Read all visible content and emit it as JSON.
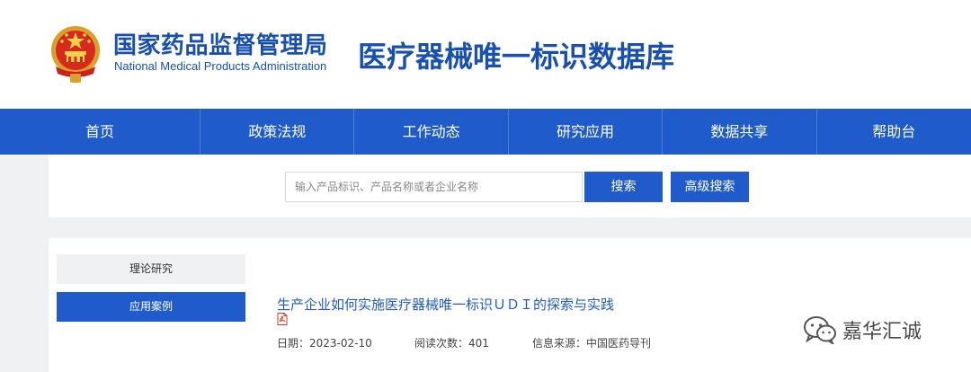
{
  "header": {
    "agency_name_cn": "国家药品监督管理局",
    "agency_name_en": "National Medical Products Administration",
    "database_title": "医疗器械唯一标识数据库",
    "brand_color": "#1750b0"
  },
  "nav": {
    "items": [
      {
        "label": "首页"
      },
      {
        "label": "政策法规"
      },
      {
        "label": "工作动态"
      },
      {
        "label": "研究应用"
      },
      {
        "label": "数据共享"
      },
      {
        "label": "帮助台"
      }
    ],
    "background": "#1f5bcb"
  },
  "search": {
    "placeholder": "输入产品标识、产品名称或者企业名称",
    "value": "",
    "search_label": "搜索",
    "advanced_label": "高级搜索"
  },
  "sidebar": {
    "items": [
      {
        "label": "理论研究",
        "active": false
      },
      {
        "label": "应用案例",
        "active": true
      }
    ]
  },
  "article": {
    "title": "生产企业如何实施医疗器械唯一标识ＵＤＩ的探索与实践",
    "attachment_icon": "pdf-icon",
    "date": "日期：2023-02-10",
    "views": "阅读次数：401",
    "source": "信息来源：中国医药导刊"
  },
  "watermark": {
    "icon": "wechat-icon",
    "text": "嘉华汇诚"
  }
}
